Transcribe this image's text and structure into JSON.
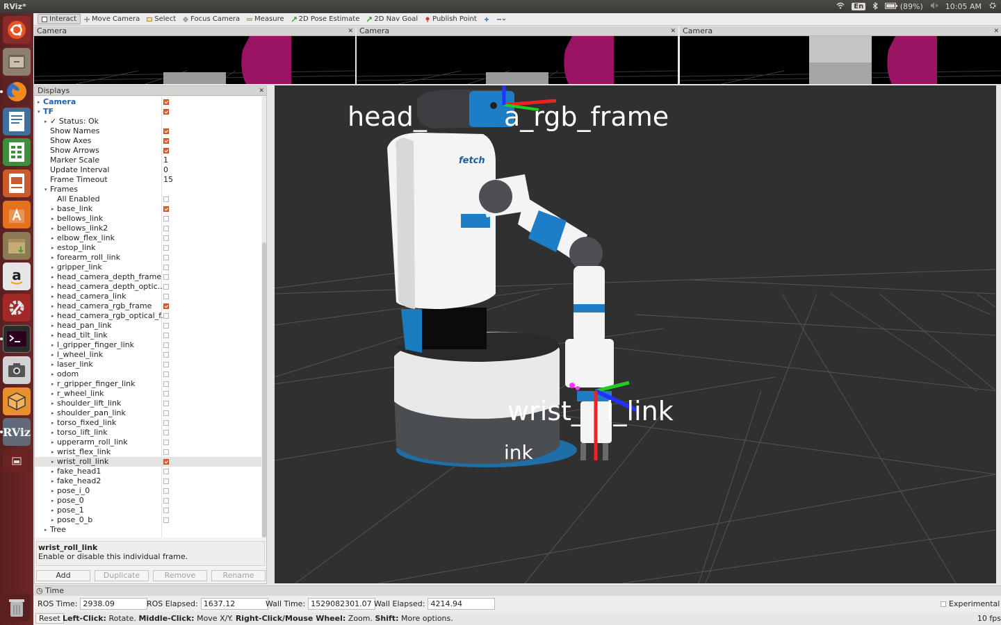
{
  "window": {
    "title": "RViz*"
  },
  "tray": {
    "lang": "En",
    "battery": "(89%)",
    "clock": "10:05 AM"
  },
  "toolbar": [
    {
      "label": "Interact",
      "active": true
    },
    {
      "label": "Move Camera"
    },
    {
      "label": "Select"
    },
    {
      "label": "Focus Camera"
    },
    {
      "label": "Measure"
    },
    {
      "label": "2D Pose Estimate"
    },
    {
      "label": "2D Nav Goal"
    },
    {
      "label": "Publish Point"
    }
  ],
  "cameras": [
    {
      "title": "Camera"
    },
    {
      "title": "Camera"
    },
    {
      "title": "Camera"
    }
  ],
  "displays": {
    "title": "Displays",
    "rows": [
      {
        "label": "Camera",
        "indent": 0,
        "arrow": "▸",
        "check": true,
        "blue": true
      },
      {
        "label": "TF",
        "indent": 0,
        "arrow": "▾",
        "check": true,
        "blue": true
      },
      {
        "label": "✓ Status: Ok",
        "indent": 1,
        "arrow": "▸"
      },
      {
        "label": "Show Names",
        "indent": 1,
        "check": true
      },
      {
        "label": "Show Axes",
        "indent": 1,
        "check": true
      },
      {
        "label": "Show Arrows",
        "indent": 1,
        "check": true
      },
      {
        "label": "Marker Scale",
        "indent": 1,
        "value": "1"
      },
      {
        "label": "Update Interval",
        "indent": 1,
        "value": "0"
      },
      {
        "label": "Frame Timeout",
        "indent": 1,
        "value": "15"
      },
      {
        "label": "Frames",
        "indent": 1,
        "arrow": "▾"
      },
      {
        "label": "All Enabled",
        "indent": 2,
        "check": false
      },
      {
        "label": "base_link",
        "indent": 2,
        "arrow": "▸",
        "check": true
      },
      {
        "label": "bellows_link",
        "indent": 2,
        "arrow": "▸",
        "check": false
      },
      {
        "label": "bellows_link2",
        "indent": 2,
        "arrow": "▸",
        "check": false
      },
      {
        "label": "elbow_flex_link",
        "indent": 2,
        "arrow": "▸",
        "check": false
      },
      {
        "label": "estop_link",
        "indent": 2,
        "arrow": "▸",
        "check": false
      },
      {
        "label": "forearm_roll_link",
        "indent": 2,
        "arrow": "▸",
        "check": false
      },
      {
        "label": "gripper_link",
        "indent": 2,
        "arrow": "▸",
        "check": false
      },
      {
        "label": "head_camera_depth_frame",
        "indent": 2,
        "arrow": "▸",
        "check": false
      },
      {
        "label": "head_camera_depth_optic...",
        "indent": 2,
        "arrow": "▸",
        "check": false
      },
      {
        "label": "head_camera_link",
        "indent": 2,
        "arrow": "▸",
        "check": false
      },
      {
        "label": "head_camera_rgb_frame",
        "indent": 2,
        "arrow": "▸",
        "check": true
      },
      {
        "label": "head_camera_rgb_optical_f...",
        "indent": 2,
        "arrow": "▸",
        "check": false
      },
      {
        "label": "head_pan_link",
        "indent": 2,
        "arrow": "▸",
        "check": false
      },
      {
        "label": "head_tilt_link",
        "indent": 2,
        "arrow": "▸",
        "check": false
      },
      {
        "label": "l_gripper_finger_link",
        "indent": 2,
        "arrow": "▸",
        "check": false
      },
      {
        "label": "l_wheel_link",
        "indent": 2,
        "arrow": "▸",
        "check": false
      },
      {
        "label": "laser_link",
        "indent": 2,
        "arrow": "▸",
        "check": false
      },
      {
        "label": "odom",
        "indent": 2,
        "arrow": "▸",
        "check": false
      },
      {
        "label": "r_gripper_finger_link",
        "indent": 2,
        "arrow": "▸",
        "check": false
      },
      {
        "label": "r_wheel_link",
        "indent": 2,
        "arrow": "▸",
        "check": false
      },
      {
        "label": "shoulder_lift_link",
        "indent": 2,
        "arrow": "▸",
        "check": false
      },
      {
        "label": "shoulder_pan_link",
        "indent": 2,
        "arrow": "▸",
        "check": false
      },
      {
        "label": "torso_fixed_link",
        "indent": 2,
        "arrow": "▸",
        "check": false
      },
      {
        "label": "torso_lift_link",
        "indent": 2,
        "arrow": "▸",
        "check": false
      },
      {
        "label": "upperarm_roll_link",
        "indent": 2,
        "arrow": "▸",
        "check": false
      },
      {
        "label": "wrist_flex_link",
        "indent": 2,
        "arrow": "▸",
        "check": false
      },
      {
        "label": "wrist_roll_link",
        "indent": 2,
        "arrow": "▸",
        "check": true,
        "selected": true
      },
      {
        "label": "fake_head1",
        "indent": 2,
        "arrow": "▸",
        "check": false
      },
      {
        "label": "fake_head2",
        "indent": 2,
        "arrow": "▸",
        "check": false
      },
      {
        "label": "pose_i_0",
        "indent": 2,
        "arrow": "▸",
        "check": false
      },
      {
        "label": "pose_0",
        "indent": 2,
        "arrow": "▸",
        "check": false
      },
      {
        "label": "pose_1",
        "indent": 2,
        "arrow": "▸",
        "check": false
      },
      {
        "label": "pose_0_b",
        "indent": 2,
        "arrow": "▸",
        "check": false
      },
      {
        "label": "Tree",
        "indent": 1,
        "arrow": "▸"
      }
    ],
    "description": {
      "title": "wrist_roll_link",
      "text": "Enable or disable this individual frame."
    },
    "buttons": {
      "add": "Add",
      "duplicate": "Duplicate",
      "remove": "Remove",
      "rename": "Rename"
    }
  },
  "viewport": {
    "labels": {
      "head": "head_",
      "rgb": "a_rgb_frame",
      "wrist_a": "wrist_",
      "wrist_b": "l_link",
      "base": "ink"
    },
    "logo": "fetch"
  },
  "time": {
    "title": "Time",
    "ros_time_label": "ROS Time:",
    "ros_time": "2938.09",
    "ros_elapsed_label": "ROS Elapsed:",
    "ros_elapsed": "1637.12",
    "wall_time_label": "Wall Time:",
    "wall_time": "1529082301.07",
    "wall_elapsed_label": "Wall Elapsed:",
    "wall_elapsed": "4214.94",
    "experimental": "Experimental"
  },
  "status": {
    "reset": "Reset",
    "left_click": "Left-Click:",
    "rotate": "Rotate.",
    "middle_click": "Middle-Click:",
    "move": "Move X/Y.",
    "right_click": "Right-Click/Mouse Wheel:",
    "zoom": "Zoom.",
    "shift": "Shift:",
    "more": "More options.",
    "fps": "10 fps"
  }
}
